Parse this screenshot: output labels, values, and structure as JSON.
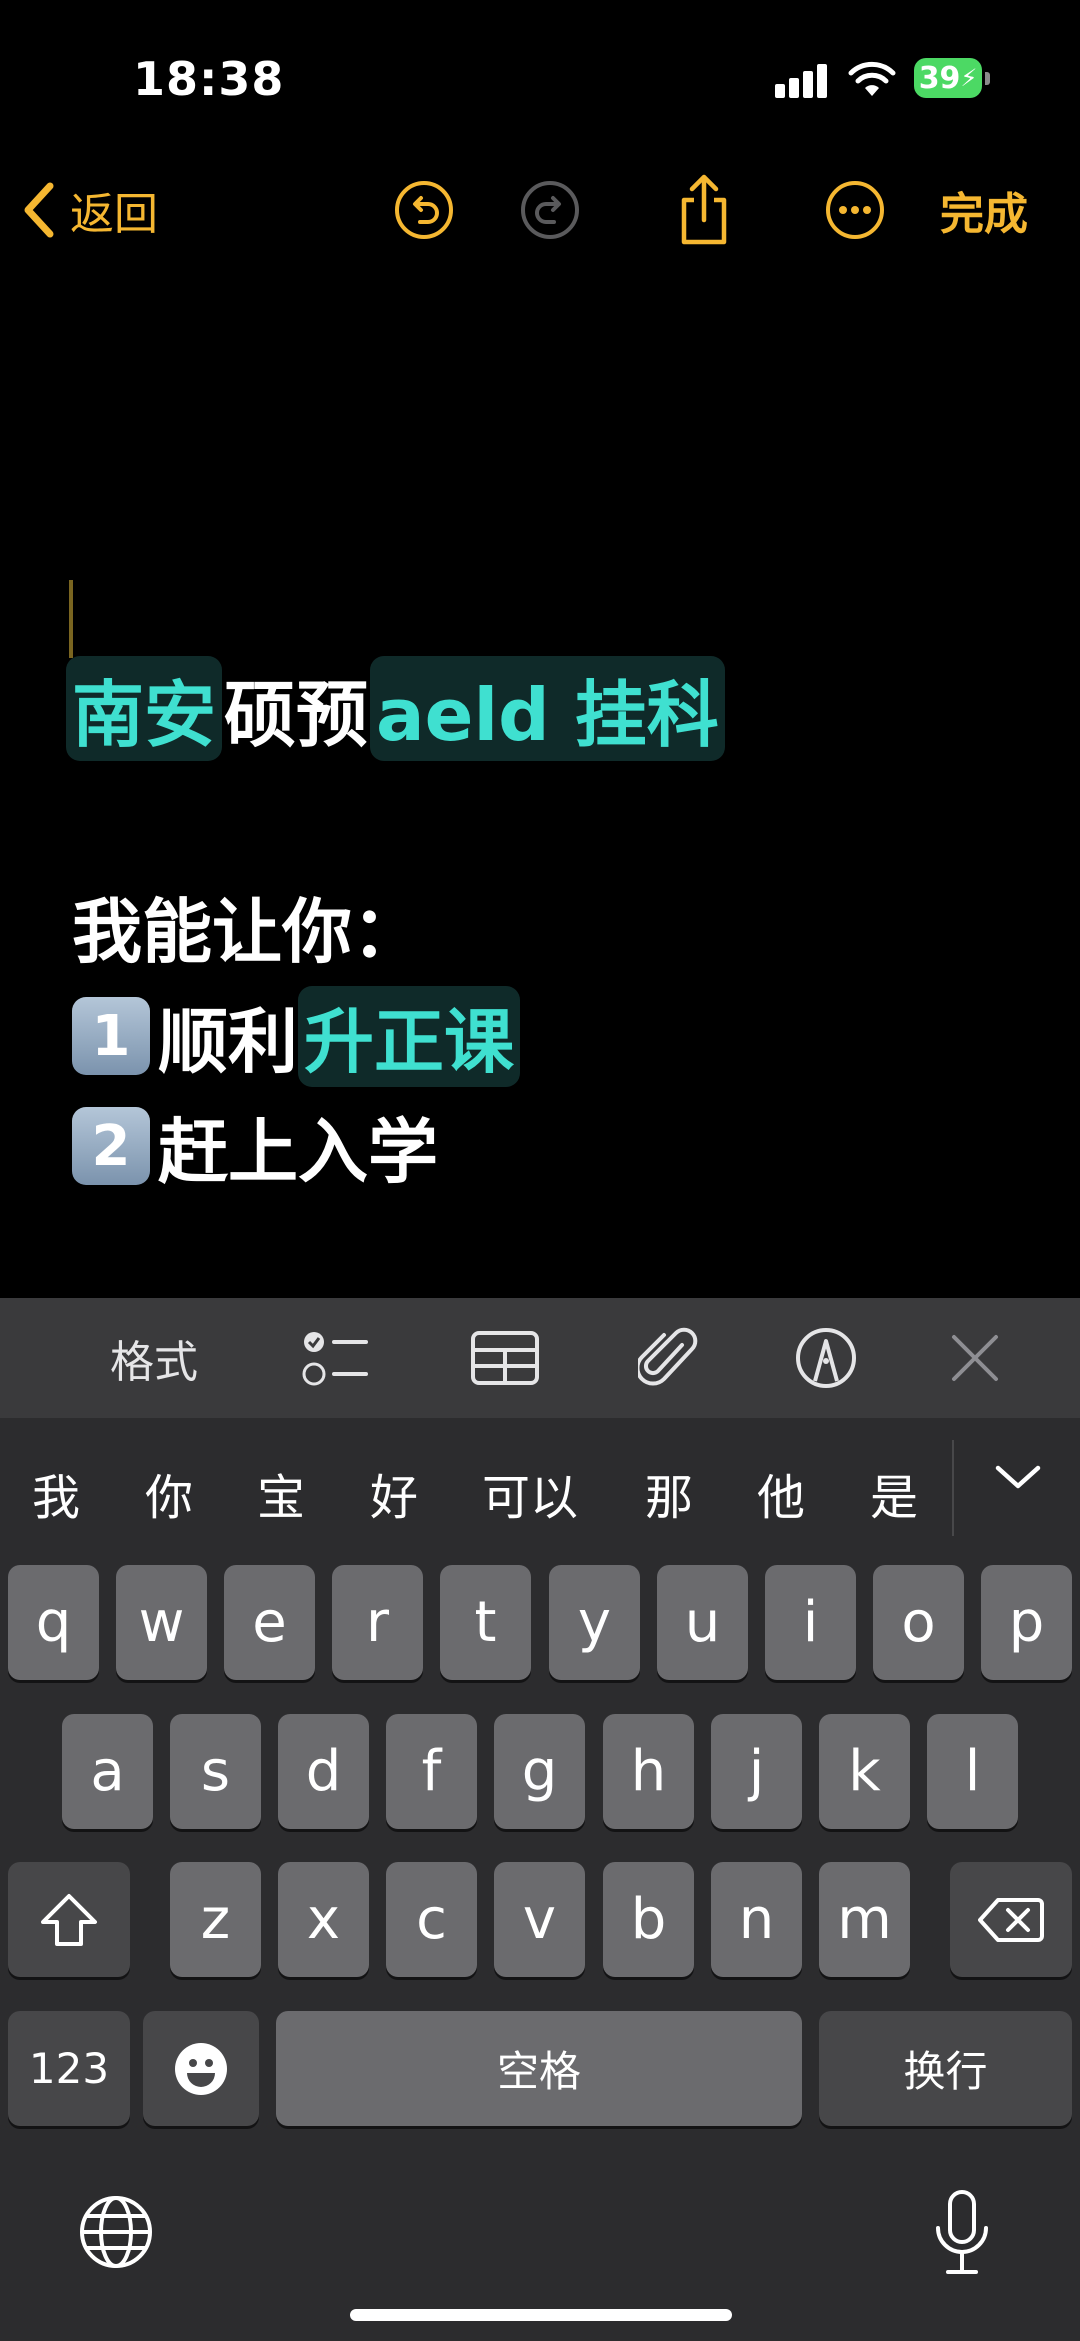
{
  "status": {
    "time": "18:38",
    "battery": "39"
  },
  "nav": {
    "back_label": "返回",
    "done_label": "完成"
  },
  "note": {
    "title_parts": [
      {
        "text": "南安",
        "highlight": true
      },
      {
        "text": "硕预",
        "highlight": false
      },
      {
        "text": "aeld 挂科",
        "highlight": true
      }
    ],
    "line1": "我能让你：",
    "item1_num": "1",
    "item1_plain": "顺利",
    "item1_hl": "升正课",
    "item2_num": "2",
    "item2_text": "赶上入学"
  },
  "toolbar": {
    "format_label": "格式"
  },
  "candidates": [
    "我",
    "你",
    "宝",
    "好",
    "可以",
    "那",
    "他",
    "是"
  ],
  "keys": {
    "row1": [
      "q",
      "w",
      "e",
      "r",
      "t",
      "y",
      "u",
      "i",
      "o",
      "p"
    ],
    "row2": [
      "a",
      "s",
      "d",
      "f",
      "g",
      "h",
      "j",
      "k",
      "l"
    ],
    "row3": [
      "z",
      "x",
      "c",
      "v",
      "b",
      "n",
      "m"
    ],
    "numbers_label": "123",
    "space_label": "空格",
    "return_label": "换行"
  },
  "colors": {
    "accent": "#f5b731",
    "highlight_text": "#3fe0d0",
    "highlight_bg": "#0f2a29"
  }
}
